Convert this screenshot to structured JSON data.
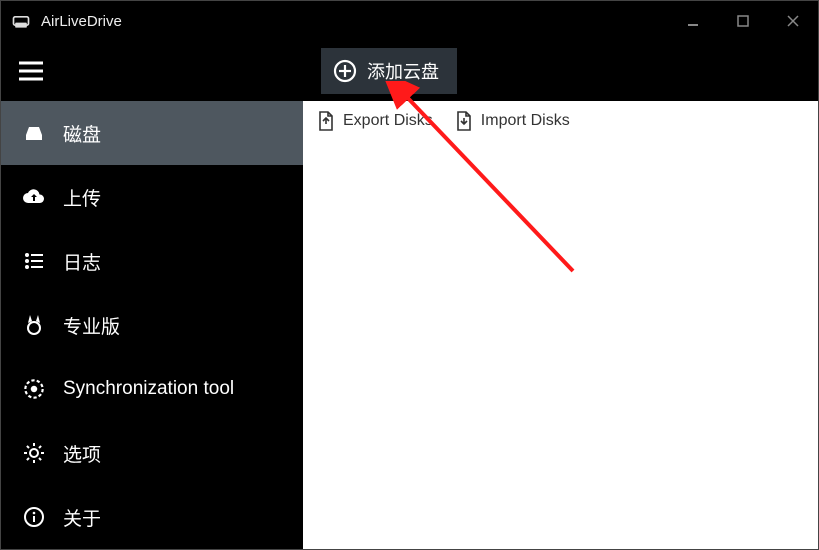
{
  "app": {
    "title": "AirLiveDrive"
  },
  "toolbar": {
    "add_cloud_label": "添加云盘"
  },
  "sidebar": {
    "items": [
      {
        "label": "磁盘"
      },
      {
        "label": "上传"
      },
      {
        "label": "日志"
      },
      {
        "label": "专业版"
      },
      {
        "label": "Synchronization tool"
      },
      {
        "label": "选项"
      },
      {
        "label": "关于"
      }
    ]
  },
  "main": {
    "export_label": "Export Disks",
    "import_label": "Import Disks"
  }
}
